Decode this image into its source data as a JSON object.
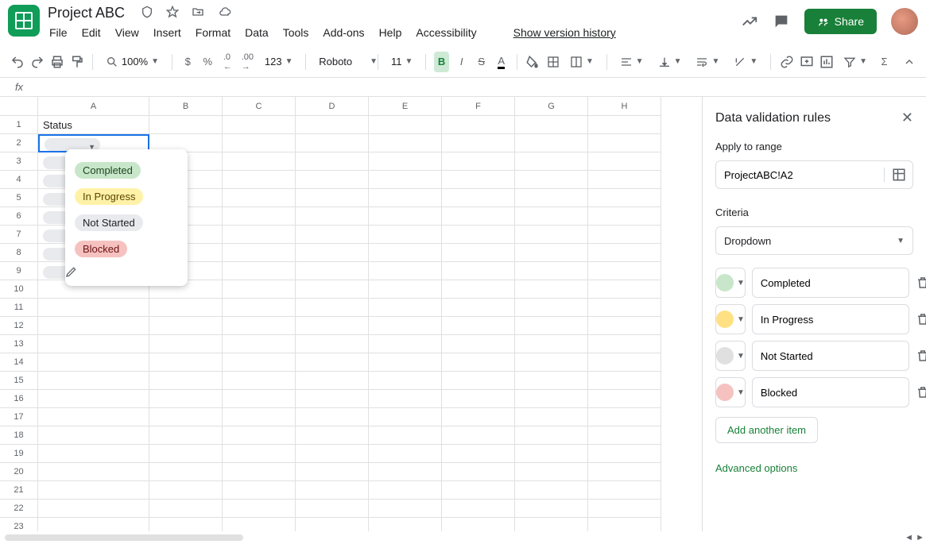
{
  "doc": {
    "title": "Project ABC"
  },
  "menubar": [
    "File",
    "Edit",
    "View",
    "Insert",
    "Format",
    "Data",
    "Tools",
    "Add-ons",
    "Help",
    "Accessibility"
  ],
  "menubar_link": "Show version history",
  "share_label": "Share",
  "toolbar": {
    "zoom": "100%",
    "number_fmt": "123",
    "font": "Roboto",
    "font_size": "11"
  },
  "columns": [
    "A",
    "B",
    "C",
    "D",
    "E",
    "F",
    "G",
    "H"
  ],
  "row_count": 23,
  "a1_value": "Status",
  "dropdown": {
    "options": [
      {
        "label": "Completed",
        "chip": "green"
      },
      {
        "label": "In Progress",
        "chip": "yellow"
      },
      {
        "label": "Not Started",
        "chip": "grey"
      },
      {
        "label": "Blocked",
        "chip": "red"
      }
    ]
  },
  "sidebar": {
    "title": "Data validation rules",
    "apply_label": "Apply to range",
    "range": "ProjectABC!A2",
    "criteria_label": "Criteria",
    "criteria_value": "Dropdown",
    "items": [
      {
        "color": "#c8e6c9",
        "value": "Completed"
      },
      {
        "color": "#ffe082",
        "value": "In Progress"
      },
      {
        "color": "#e0e0e0",
        "value": "Not Started"
      },
      {
        "color": "#f5c2c0",
        "value": "Blocked"
      }
    ],
    "add_label": "Add another item",
    "adv_label": "Advanced options"
  }
}
